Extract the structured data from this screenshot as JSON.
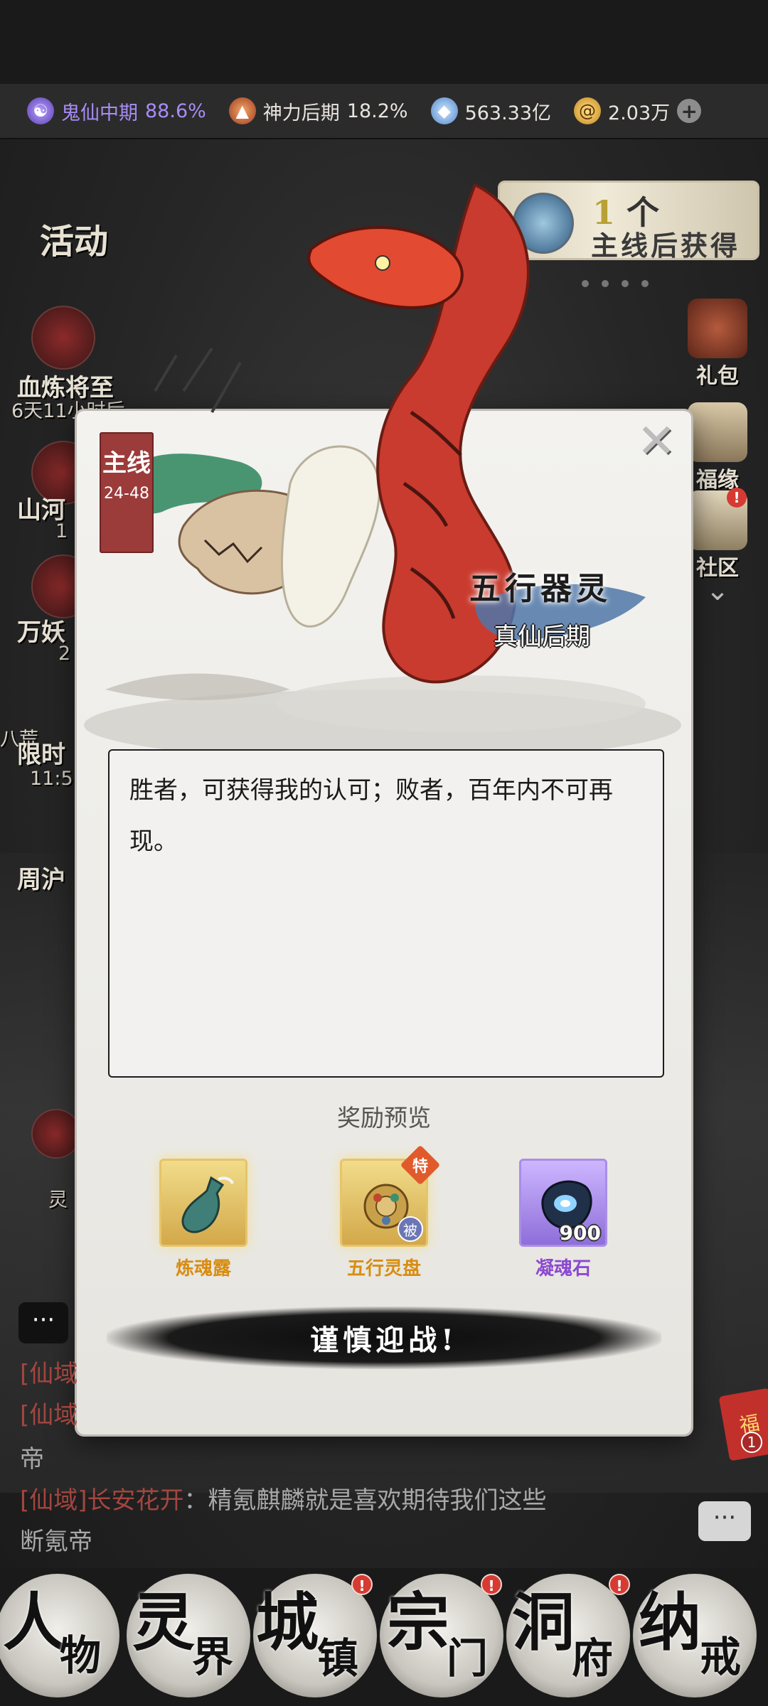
{
  "resources": [
    {
      "icon": "ghost-realm-icon",
      "label": "鬼仙中期",
      "value": "88.6%"
    },
    {
      "icon": "divine-power-icon",
      "label": "神力后期",
      "value": "18.2%"
    },
    {
      "icon": "spirit-drop-icon",
      "value": "563.33亿"
    },
    {
      "icon": "coin-icon",
      "value": "2.03万"
    }
  ],
  "left_panel": {
    "activity_label": "活动",
    "event1_name": "血炼将至",
    "event1_time": "6天11小时后",
    "event2_name": "山河",
    "event2_time": "1",
    "event3_name": "万妖",
    "event3_time": "2",
    "event4_name": "八荒",
    "event5_name": "限时",
    "event5_time": "11:5",
    "event6_name": "周沪",
    "event7_name": "灵"
  },
  "quest_banner": {
    "count": "1",
    "unit": "个",
    "hint": "主线后获得"
  },
  "right_panel": [
    {
      "label": "礼包"
    },
    {
      "label": "福缘"
    },
    {
      "label": "社区",
      "badge": "!"
    }
  ],
  "dialog": {
    "tag_main": "主线",
    "tag_stage": "24-48",
    "boss_name": "五行器灵",
    "boss_realm": "真仙后期",
    "close_icon": "✕",
    "quote": "胜者，可获得我的认可；败者，百年内不可再现。",
    "reward_title": "奖励预览",
    "rewards": [
      {
        "name": "炼魂露",
        "quality": "gold"
      },
      {
        "name": "五行灵盘",
        "quality": "gold",
        "special_badge": "特",
        "passive_badge": "被"
      },
      {
        "name": "凝魂石",
        "quality": "purple",
        "qty": "900"
      }
    ],
    "fight_label": "谨慎迎战!"
  },
  "chat": {
    "line1_channel": "[仙域",
    "line2_channel": "[仙域",
    "line3_text": "帝",
    "line4_channel": "[仙域]",
    "line4_name": "长安花开",
    "line4_text": "：精氪麒麟就是喜欢期待我们这些",
    "line5_text": "断氪帝",
    "envelope_label": "福",
    "envelope_count": "1"
  },
  "bottom_nav": [
    {
      "big": "人",
      "small": "物"
    },
    {
      "big": "灵",
      "small": "界"
    },
    {
      "big": "城",
      "small": "镇",
      "badge": "!"
    },
    {
      "big": "宗",
      "small": "门",
      "badge": "!"
    },
    {
      "big": "洞",
      "small": "府",
      "badge": "!"
    },
    {
      "big": "纳",
      "small": "戒"
    }
  ],
  "colors": {
    "accent_purple": "#a88cf6",
    "tag_red": "#9b3b3a",
    "reward_gold": "#d78d12",
    "reward_purple": "#8b49d1",
    "chat_channel": "#a2463f"
  }
}
